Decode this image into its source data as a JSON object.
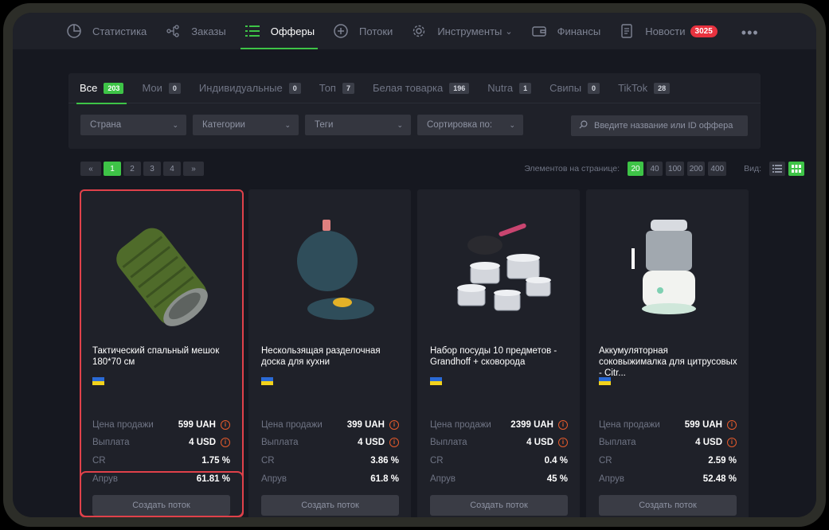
{
  "nav": {
    "items": [
      {
        "label": "Статистика",
        "icon": "pie-chart-icon"
      },
      {
        "label": "Заказы",
        "icon": "orders-icon"
      },
      {
        "label": "Офферы",
        "icon": "list-icon",
        "active": true
      },
      {
        "label": "Потоки",
        "icon": "plus-circle-icon"
      },
      {
        "label": "Инструменты",
        "icon": "gear-icon",
        "chevron": "⌄"
      },
      {
        "label": "Финансы",
        "icon": "wallet-icon"
      },
      {
        "label": "Новости",
        "icon": "document-icon",
        "badge": "3025"
      }
    ],
    "more": "•••"
  },
  "tabs": [
    {
      "label": "Все",
      "count": "203",
      "active": true
    },
    {
      "label": "Мои",
      "count": "0"
    },
    {
      "label": "Индивидуальные",
      "count": "0"
    },
    {
      "label": "Топ",
      "count": "7"
    },
    {
      "label": "Белая товарка",
      "count": "196"
    },
    {
      "label": "Nutra",
      "count": "1"
    },
    {
      "label": "Свипы",
      "count": "0"
    },
    {
      "label": "TikTok",
      "count": "28"
    }
  ],
  "filters": {
    "country": "Страна",
    "category": "Категории",
    "tags": "Теги",
    "sort": "Сортировка по:",
    "search_placeholder": "Введите название или ID оффера"
  },
  "pager": {
    "prev": "«",
    "pages": [
      "1",
      "2",
      "3",
      "4"
    ],
    "next": "»"
  },
  "per_page": {
    "label": "Элементов на странице:",
    "options": [
      "20",
      "40",
      "100",
      "200",
      "400"
    ],
    "selected": "20"
  },
  "view": {
    "label": "Вид:",
    "mode": "grid"
  },
  "labels": {
    "price": "Цена продажи",
    "payout": "Выплата",
    "cr": "CR",
    "approve": "Апрув",
    "create": "Создать поток"
  },
  "offers": [
    {
      "title": "Тактический спальный мешок 180*70 см",
      "price": "599 UAH",
      "payout": "4 USD",
      "cr": "1.75 %",
      "approve": "61.81 %"
    },
    {
      "title": "Нескользящая разделочная доска для кухни",
      "price": "399 UAH",
      "payout": "4 USD",
      "cr": "3.86 %",
      "approve": "61.8 %"
    },
    {
      "title": "Набор посуды 10 предметов - Grandhoff + сковорода",
      "price": "2399 UAH",
      "payout": "4 USD",
      "cr": "0.4 %",
      "approve": "45 %"
    },
    {
      "title": "Аккумуляторная соковыжималка для цитрусовых - Citr...",
      "price": "599 UAH",
      "payout": "4 USD",
      "cr": "2.59 %",
      "approve": "52.48 %"
    }
  ],
  "colors": {
    "accent": "#3ec447",
    "badge": "#e8323f",
    "highlight": "#e0414a"
  }
}
